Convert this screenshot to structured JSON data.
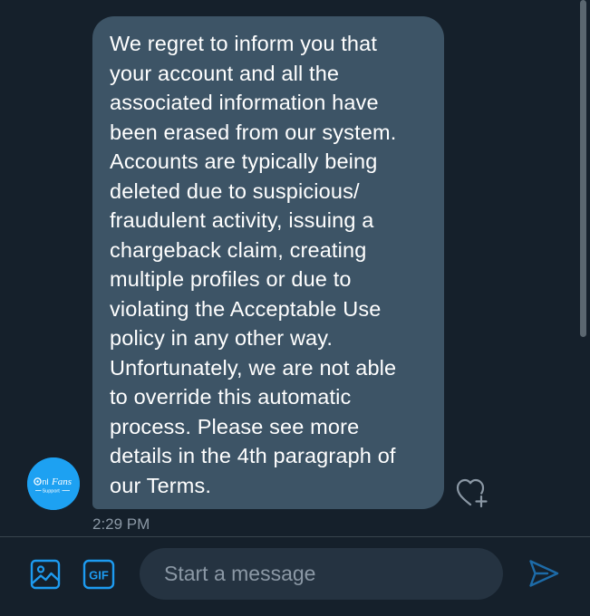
{
  "colors": {
    "background": "#15202b",
    "bubble": "#3d5466",
    "accent": "#1d9bf0",
    "muted_text": "#8b98a5",
    "input_background": "#253341"
  },
  "conversation": {
    "message": {
      "text": "We regret to inform you that\nyour account and all the\nassociated information have\nbeen erased from our system.\nAccounts are typically being\ndeleted due to suspicious/\nfraudulent activity, issuing a\nchargeback claim, creating\nmultiple profiles or due to\nviolating the Acceptable Use\npolicy in any other way.\nUnfortunately, we are not able\nto override this automatic\nprocess. Please see more\ndetails in the 4th paragraph of\nour Terms.",
      "timestamp": "2:29 PM",
      "reaction_icon": "heart-plus-icon"
    },
    "sender_avatar": {
      "logo_text": "onlyfans",
      "logo_subtext": "Support"
    }
  },
  "composer": {
    "placeholder": "Start a message",
    "media_icon": "image-icon",
    "gif_label": "GIF",
    "send_icon": "send-icon"
  }
}
